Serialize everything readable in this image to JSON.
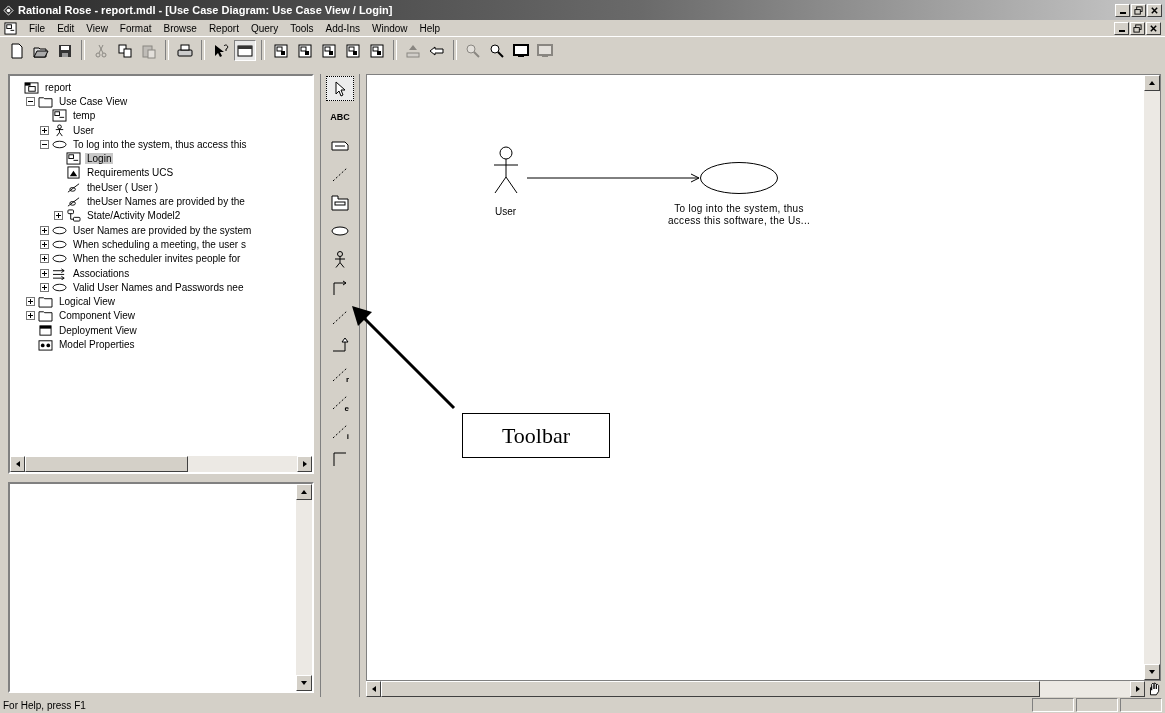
{
  "window": {
    "title": "Rational Rose - report.mdl - [Use Case Diagram: Use Case View / Login]"
  },
  "menu": [
    "File",
    "Edit",
    "View",
    "Format",
    "Browse",
    "Report",
    "Query",
    "Tools",
    "Add-Ins",
    "Window",
    "Help"
  ],
  "toolbar": [
    {
      "kind": "new",
      "disabled": false,
      "pressed": false
    },
    {
      "kind": "open",
      "disabled": false,
      "pressed": false
    },
    {
      "kind": "save",
      "disabled": false,
      "pressed": false
    },
    {
      "kind": "separator"
    },
    {
      "kind": "cut",
      "disabled": true,
      "pressed": false
    },
    {
      "kind": "copy",
      "disabled": false,
      "pressed": false
    },
    {
      "kind": "paste",
      "disabled": true,
      "pressed": false
    },
    {
      "kind": "separator"
    },
    {
      "kind": "print",
      "disabled": false,
      "pressed": false
    },
    {
      "kind": "separator"
    },
    {
      "kind": "help",
      "disabled": false,
      "pressed": false
    },
    {
      "kind": "documentation",
      "disabled": false,
      "pressed": true
    },
    {
      "kind": "separator"
    },
    {
      "kind": "class-diagram",
      "disabled": false,
      "pressed": false
    },
    {
      "kind": "usecase-diagram",
      "disabled": false,
      "pressed": false
    },
    {
      "kind": "component-diagram",
      "disabled": false,
      "pressed": false
    },
    {
      "kind": "state-diagram",
      "disabled": false,
      "pressed": false
    },
    {
      "kind": "deployment-diagram",
      "disabled": false,
      "pressed": false
    },
    {
      "kind": "separator"
    },
    {
      "kind": "parent",
      "disabled": true,
      "pressed": false
    },
    {
      "kind": "previous",
      "disabled": false,
      "pressed": false
    },
    {
      "kind": "separator"
    },
    {
      "kind": "zoom-in",
      "disabled": true,
      "pressed": false
    },
    {
      "kind": "zoom-out",
      "disabled": false,
      "pressed": false
    },
    {
      "kind": "fit",
      "disabled": false,
      "pressed": false
    },
    {
      "kind": "undo-fit",
      "disabled": true,
      "pressed": false
    }
  ],
  "browser": {
    "tree": [
      {
        "label": "report",
        "kind": "model",
        "selected": false,
        "children": [
          {
            "label": "Use Case View",
            "kind": "folder",
            "expanded": true,
            "selected": false,
            "children": [
              {
                "label": "temp",
                "kind": "class-diagram",
                "selected": false
              },
              {
                "label": "User",
                "kind": "actor",
                "expanded": false,
                "selected": false
              },
              {
                "label": "To log into the system, thus access this",
                "kind": "usecase",
                "expanded": true,
                "selected": false,
                "children": [
                  {
                    "label": "Login",
                    "kind": "usecase-diagram",
                    "selected": true
                  },
                  {
                    "label": "Requirements UCS",
                    "kind": "document",
                    "selected": false
                  },
                  {
                    "label": "theUser ( User )",
                    "kind": "association",
                    "selected": false
                  },
                  {
                    "label": "theUser Names are provided by the",
                    "kind": "association",
                    "selected": false
                  },
                  {
                    "label": "State/Activity Model2",
                    "kind": "state-model",
                    "expanded": false,
                    "selected": false
                  }
                ]
              },
              {
                "label": "User Names are provided by the system",
                "kind": "usecase",
                "expanded": false,
                "selected": false
              },
              {
                "label": "When scheduling a meeting, the user s",
                "kind": "usecase",
                "expanded": false,
                "selected": false
              },
              {
                "label": "When the scheduler invites people for",
                "kind": "usecase",
                "expanded": false,
                "selected": false
              },
              {
                "label": "Associations",
                "kind": "associations",
                "expanded": false,
                "selected": false
              },
              {
                "label": "Valid  User Names and Passwords nee",
                "kind": "usecase",
                "expanded": false,
                "selected": false
              }
            ]
          },
          {
            "label": "Logical View",
            "kind": "folder",
            "expanded": false,
            "selected": false
          },
          {
            "label": "Component View",
            "kind": "folder",
            "expanded": false,
            "selected": false
          },
          {
            "label": "Deployment View",
            "kind": "deployment",
            "selected": false
          },
          {
            "label": "Model Properties",
            "kind": "properties",
            "selected": false
          }
        ]
      }
    ]
  },
  "diagram_toolbox": [
    {
      "kind": "pointer",
      "selected": true
    },
    {
      "kind": "text",
      "label": "ABC",
      "selected": false
    },
    {
      "kind": "note",
      "selected": false
    },
    {
      "kind": "anchor",
      "selected": false
    },
    {
      "kind": "package",
      "selected": false
    },
    {
      "kind": "usecase",
      "selected": false
    },
    {
      "kind": "actor",
      "selected": false
    },
    {
      "kind": "association",
      "selected": false
    },
    {
      "kind": "dependency",
      "selected": false
    },
    {
      "kind": "generalization",
      "selected": false
    },
    {
      "kind": "stereotype-link",
      "letter": "r",
      "selected": false
    },
    {
      "kind": "stereotype-link",
      "letter": "e",
      "selected": false
    },
    {
      "kind": "stereotype-link",
      "letter": "i",
      "selected": false
    },
    {
      "kind": "corner",
      "selected": false
    }
  ],
  "diagram": {
    "actor": {
      "label": "User"
    },
    "usecase": {
      "label_lines": [
        "To log into the system, thus",
        "access this software, the Us..."
      ]
    }
  },
  "callout": {
    "text": "Toolbar"
  },
  "status_bar": {
    "text": "For Help, press F1"
  }
}
